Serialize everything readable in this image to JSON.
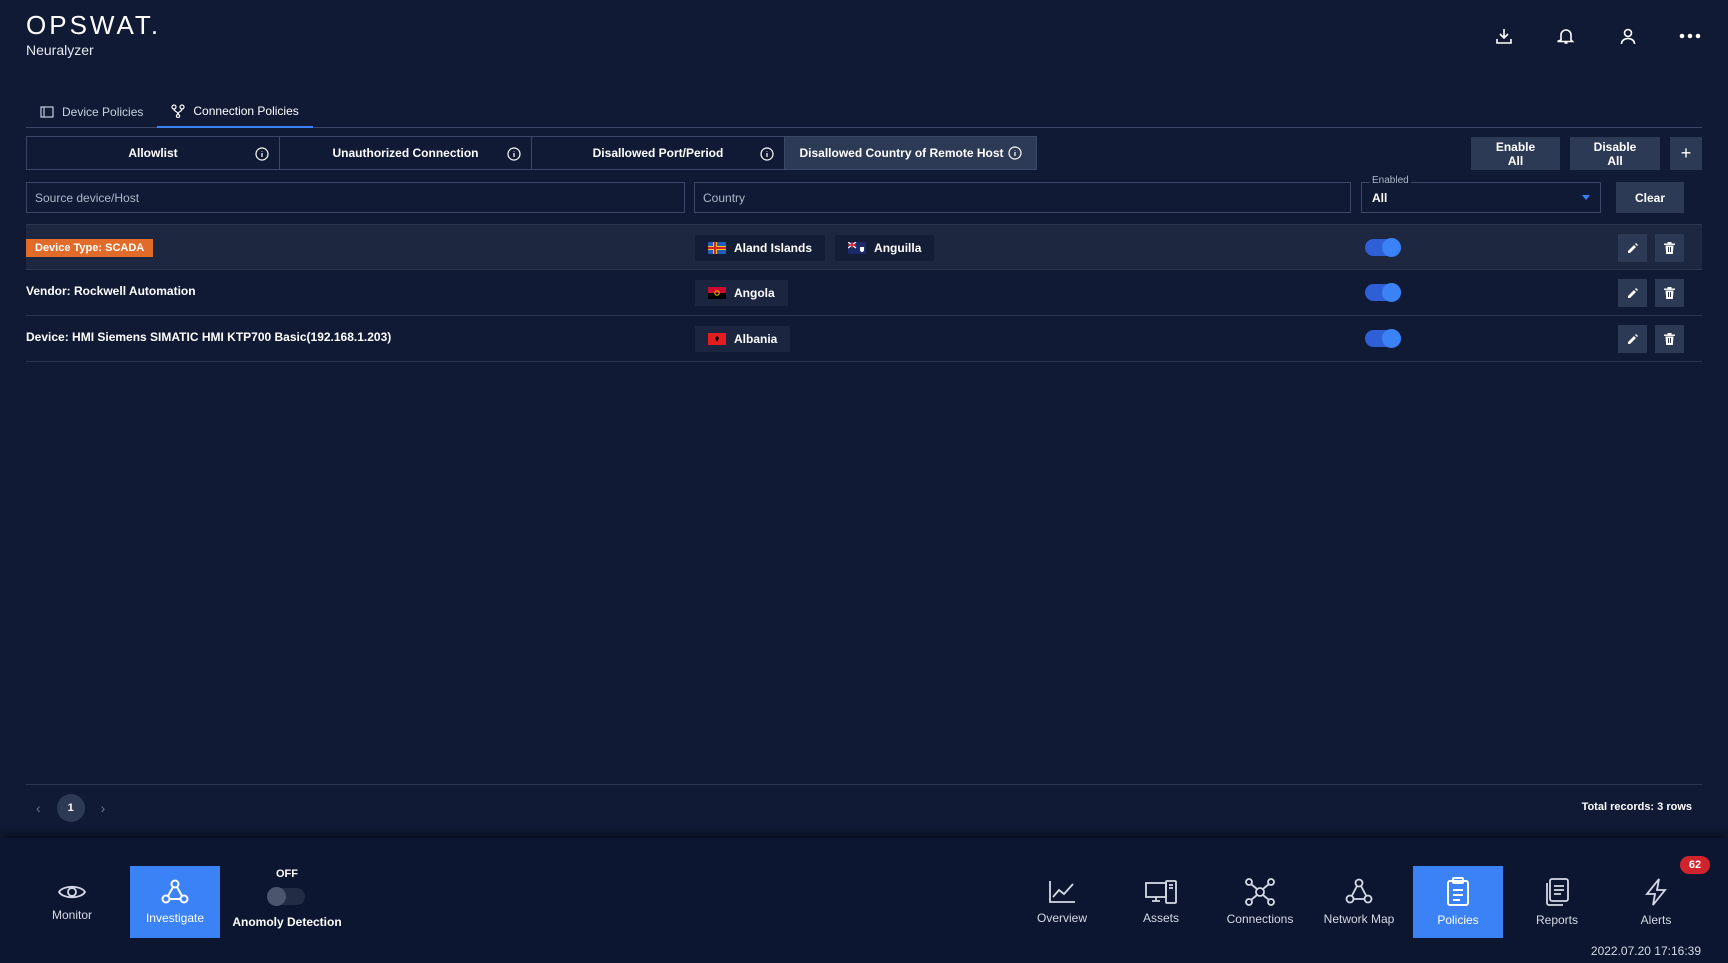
{
  "brand": {
    "logo": "OPSWAT.",
    "product": "Neuralyzer"
  },
  "header_icons": [
    "download-icon",
    "bell-icon",
    "user-icon",
    "more-icon"
  ],
  "tabs": [
    {
      "label": "Device Policies",
      "icon": "device-icon",
      "active": false
    },
    {
      "label": "Connection Policies",
      "icon": "connection-icon",
      "active": true
    }
  ],
  "subtabs": [
    {
      "label": "Allowlist",
      "active": false
    },
    {
      "label": "Unauthorized Connection",
      "active": false
    },
    {
      "label": "Disallowed Port/Period",
      "active": false
    },
    {
      "label": "Disallowed Country of Remote Host",
      "active": true
    }
  ],
  "toolbar": {
    "enable_all": "Enable All",
    "disable_all": "Disable All",
    "add": "+"
  },
  "filters": {
    "source_placeholder": "Source device/Host",
    "country_placeholder": "Country",
    "enabled_label": "Enabled",
    "enabled_value": "All",
    "clear_label": "Clear"
  },
  "rows": [
    {
      "source": "Device Type: SCADA",
      "is_badge": true,
      "countries": [
        "Aland Islands",
        "Anguilla"
      ],
      "enabled": true
    },
    {
      "source": "Vendor: Rockwell Automation",
      "is_badge": false,
      "countries": [
        "Angola"
      ],
      "enabled": true
    },
    {
      "source": "Device: HMI Siemens SIMATIC HMI KTP700 Basic(192.168.1.203)",
      "is_badge": false,
      "countries": [
        "Albania"
      ],
      "enabled": true
    }
  ],
  "pagination": {
    "current_page": "1",
    "total_records": "Total records: 3 rows"
  },
  "bottom_nav": {
    "monitor": "Monitor",
    "investigate": "Investigate",
    "anomaly_state": "OFF",
    "anomaly_label": "Anomoly Detection",
    "overview": "Overview",
    "assets": "Assets",
    "connections": "Connections",
    "network_map": "Network Map",
    "policies": "Policies",
    "reports": "Reports",
    "alerts": "Alerts",
    "alerts_count": "62",
    "timestamp": "2022.07.20 17:16:39"
  },
  "colors": {
    "background": "#101a35",
    "accent": "#3b82f6",
    "badge": "#e16c2a",
    "alert": "#d0232b"
  }
}
